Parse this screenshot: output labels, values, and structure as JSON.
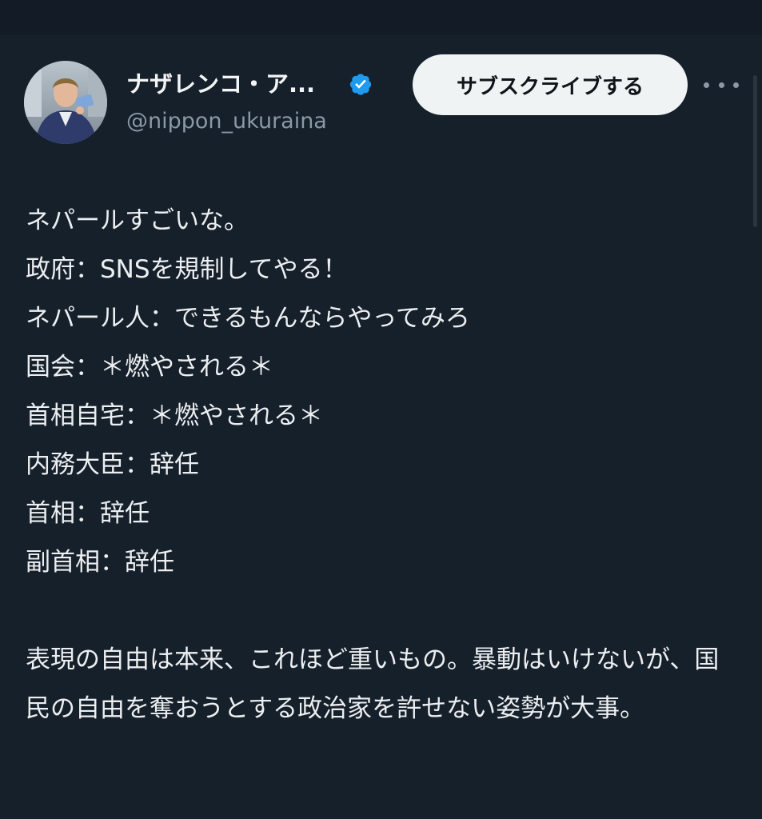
{
  "author": {
    "display_name": "ナザレンコ・ア...",
    "handle": "@nippon_ukuraina",
    "verified": true,
    "verified_color": "#1d9bf0"
  },
  "actions": {
    "subscribe_label": "サブスクライブする",
    "more_icon": "more-horizontal-icon"
  },
  "tweet": {
    "lines": [
      "ネパールすごいな。",
      "政府：SNSを規制してやる！",
      "ネパール人：できるもんならやってみろ",
      "国会：＊燃やされる＊",
      "首相自宅：＊燃やされる＊",
      "内務大臣：辞任",
      "首相：辞任",
      "副首相：辞任"
    ],
    "closing_paragraph": "表現の自由は本来、これほど重いもの。暴動はいけないが、国民の自由を奪おうとする政治家を許せない姿勢が大事。"
  },
  "colors": {
    "background": "#15202b",
    "text": "#e7e9ea",
    "secondary_text": "#8b98a5",
    "button_bg": "#eff3f4"
  }
}
